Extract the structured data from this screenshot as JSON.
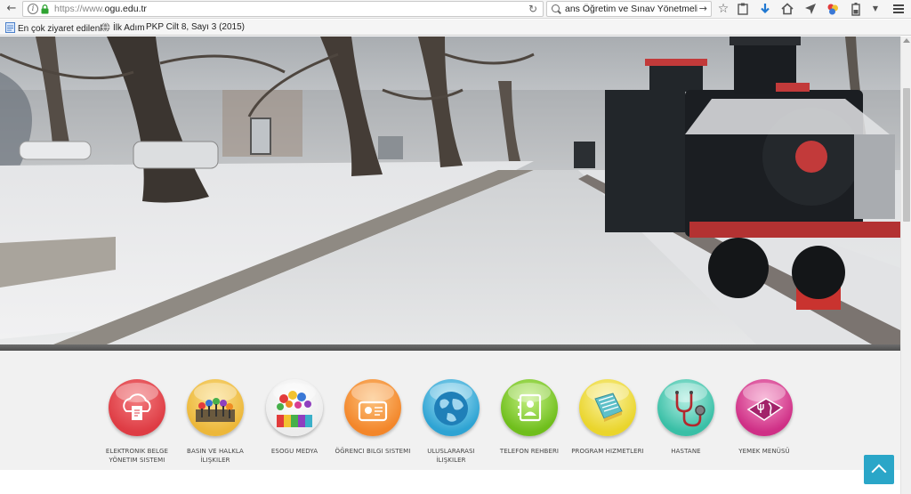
{
  "browser": {
    "url_prefix": "https://www.",
    "url_domain": "ogu.edu.tr",
    "search_query": "ans Öğretim ve Sınav Yönetmeliği",
    "bookmarks": [
      {
        "label": "En çok ziyaret edilenler"
      },
      {
        "label": "İlk Adım"
      },
      {
        "label": "PKP Cilt 8, Sayı 3 (2015)"
      }
    ]
  },
  "menu": [
    {
      "label": "Elektronik Belge Yönetim Sistemi",
      "icon": "cloud-document-icon",
      "color": "#e8484f"
    },
    {
      "label": "Basın ve Halkla İlişkiler",
      "icon": "microphones-icon",
      "color": "#f2c14a"
    },
    {
      "label": "ESOGU Medya",
      "icon": "media-colors-icon",
      "color": "#ffffff"
    },
    {
      "label": "Öğrenci Bilgi Sistemi",
      "icon": "student-card-icon",
      "color": "#f7932e"
    },
    {
      "label": "Uluslararası İlişkiler",
      "icon": "globe-icon",
      "color": "#3fb4de"
    },
    {
      "label": "Telefon Rehberi",
      "icon": "phonebook-icon",
      "color": "#86cc2d"
    },
    {
      "label": "Program Hizmetleri",
      "icon": "program-book-icon",
      "color": "#f5e24c"
    },
    {
      "label": "Hastane",
      "icon": "stethoscope-icon",
      "color": "#54cbb5"
    },
    {
      "label": "Yemek Menüsü",
      "icon": "food-menu-icon",
      "color": "#d93d92"
    }
  ]
}
